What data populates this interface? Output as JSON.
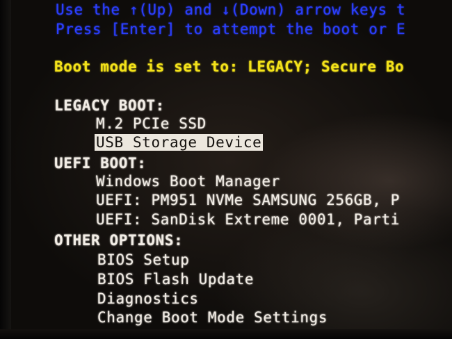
{
  "instructions": {
    "line1": "Use the ↑(Up) and ↓(Down) arrow keys t",
    "line2": "Press [Enter] to attempt the boot or E"
  },
  "boot_mode_line": "Boot mode is set to: LEGACY; Secure Bo",
  "legacy_boot": {
    "header": "LEGACY BOOT:",
    "items": [
      "M.2 PCIe SSD",
      "USB Storage Device"
    ],
    "selected_index": 1
  },
  "uefi_boot": {
    "header": "UEFI BOOT:",
    "items": [
      "Windows Boot Manager",
      "UEFI: PM951 NVMe SAMSUNG 256GB, P",
      "UEFI: SanDisk Extreme 0001, Parti"
    ]
  },
  "other_options": {
    "header": "OTHER OPTIONS:",
    "items": [
      "BIOS Setup",
      "BIOS Flash Update",
      "Diagnostics",
      "Change Boot Mode Settings"
    ]
  },
  "colors": {
    "instruction": "#2b3fff",
    "boot_mode": "#f3e21a",
    "text": "#f2ede6",
    "highlight_bg": "#ece7de"
  }
}
